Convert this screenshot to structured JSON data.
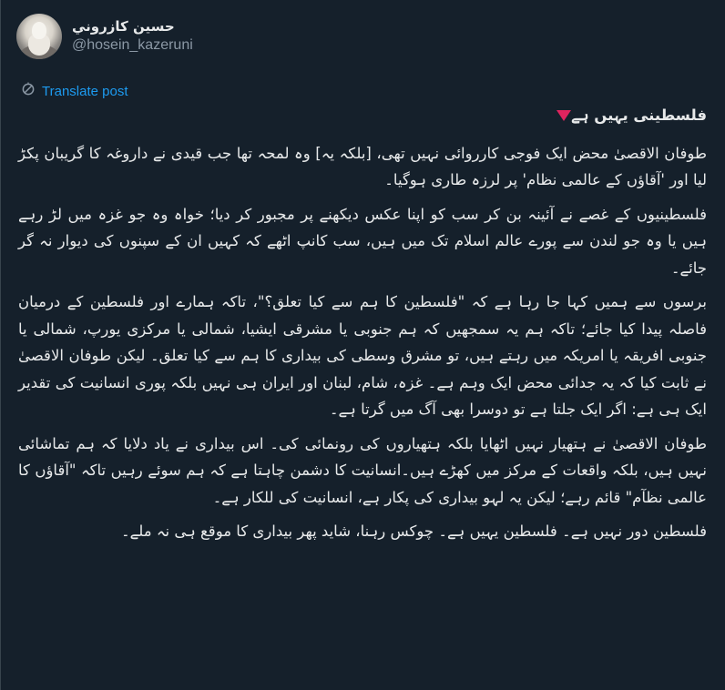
{
  "author": {
    "display_name": "حسين كازروني",
    "handle": "@hosein_kazeruni"
  },
  "translate": {
    "label": "Translate post",
    "icon": "translate-icon"
  },
  "post": {
    "title_icon": "red-triangle-down",
    "title": "فلسطینی یہیں ہے",
    "paragraphs": [
      "طوفان الاقصیٰ محض ایک فوجی کارروائی نہیں تھی، [بلکہ یہ] وہ لمحہ تھا جب قیدی نے داروغہ کا گریبان پکڑ لیا اور 'آقاؤں کے عالمی نظام' پر لرزہ طاری ہوگیا۔",
      "فلسطینیوں کے غصے نے آئینہ بن کر سب کو اپنا عکس دیکھنے پر مجبور کر دیا؛ خواہ وہ جو غزہ میں لڑ رہے ہیں یا وہ جو لندن سے پورے عالم اسلام تک میں ہیں، سب کانپ اٹھے کہ کہیں ان کے سپنوں کی دیوار نہ گر جائے۔",
      "برسوں سے ہمیں کہا جا رہا ہے کہ \"فلسطین کا ہم سے کیا تعلق؟\"، تاکہ ہمارے اور فلسطین کے درمیان فاصلہ پیدا کیا جائے؛ تاکہ ہم یہ سمجھیں کہ ہم جنوبی یا مشرقی ایشیا، شمالی یا مرکزی یورپ، شمالی یا جنوبی افریقہ یا امریکہ میں رہتے ہیں، تو مشرق وسطی کی بیداری کا ہم سے کیا تعلق۔ لیکن طوفان الاقصیٰ نے ثابت کیا کہ یہ جدائی محض ایک وہم ہے۔ غزہ، شام، لبنان اور ایران ہی نہیں بلکہ پوری انسانیت کی تقدیر ایک ہی ہے: اگر ایک جلتا ہے تو دوسرا بھی آگ میں گرتا ہے۔",
      "طوفان الاقصیٰ نے ہتھیار نہیں اٹھایا بلکہ ہتھیاروں کی رونمائی کی۔ اس بیداری نے یاد دلایا کہ ہم تماشائی نہیں ہیں، بلکہ واقعات کے مرکز میں کھڑے ہیں۔انسانیت کا دشمن چاہتا ہے کہ ہم سوئے رہیں تاکہ \"آقاؤں کا عالمی نظآم\" قائم رہے؛ لیکن یہ لہو بیداری کی پکار ہے، انسانیت کی للکار ہے۔",
      "فلسطین دور نہیں ہے۔ فلسطین یہیں ہے۔ چوکس رہنا، شاید پھر بیداری کا موقع ہی نہ ملے۔"
    ]
  },
  "colors": {
    "background": "#15202b",
    "text": "#e7e9ea",
    "muted": "#8b98a5",
    "link": "#1d9bf0",
    "triangle": "#e0245e"
  }
}
